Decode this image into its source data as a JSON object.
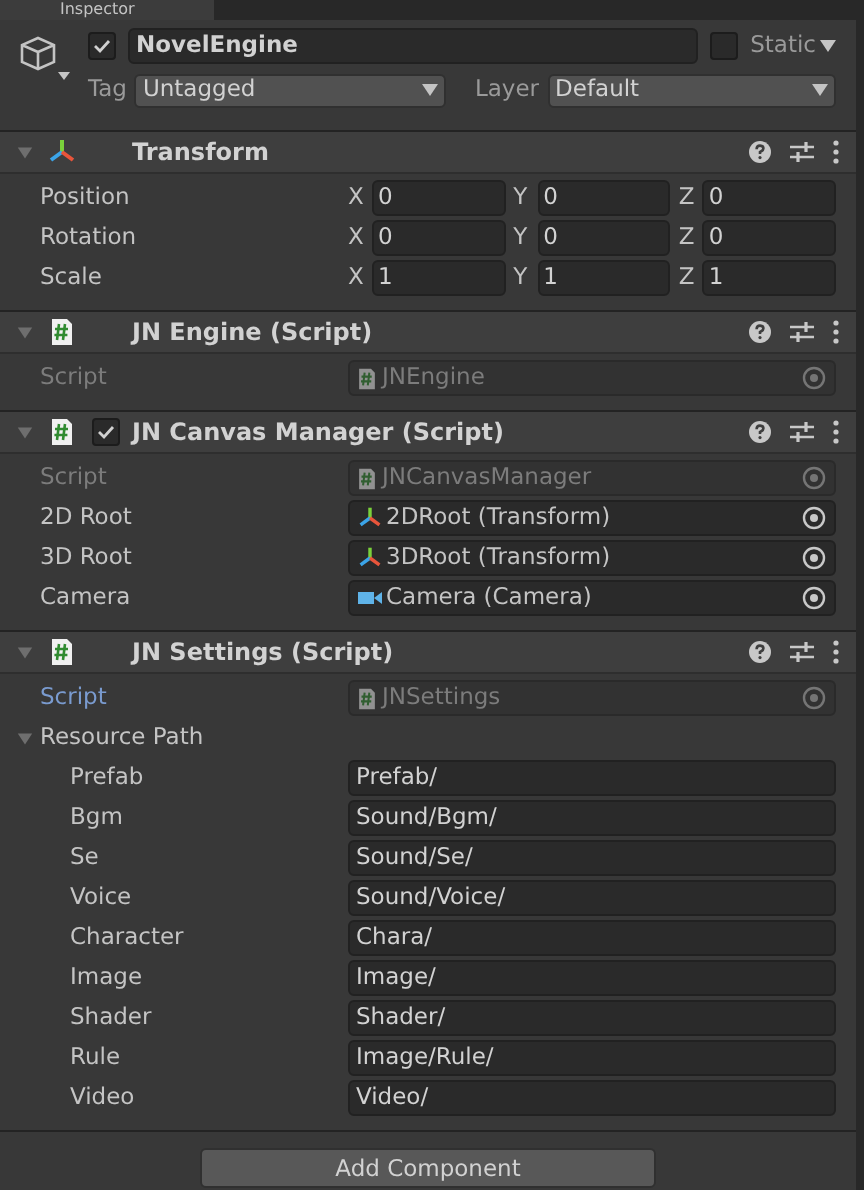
{
  "tab": {
    "title": "Inspector"
  },
  "object": {
    "active": true,
    "name": "NovelEngine",
    "static": false,
    "static_label": "Static",
    "tag_label": "Tag",
    "tag": "Untagged",
    "layer_label": "Layer",
    "layer": "Default"
  },
  "components": [
    {
      "kind": "transform",
      "title": "Transform",
      "expanded": true,
      "rows": [
        {
          "label": "Position",
          "values": [
            {
              "axis": "X",
              "value": "0"
            },
            {
              "axis": "Y",
              "value": "0"
            },
            {
              "axis": "Z",
              "value": "0"
            }
          ]
        },
        {
          "label": "Rotation",
          "values": [
            {
              "axis": "X",
              "value": "0"
            },
            {
              "axis": "Y",
              "value": "0"
            },
            {
              "axis": "Z",
              "value": "0"
            }
          ]
        },
        {
          "label": "Scale",
          "values": [
            {
              "axis": "X",
              "value": "1"
            },
            {
              "axis": "Y",
              "value": "1"
            },
            {
              "axis": "Z",
              "value": "1"
            }
          ]
        }
      ]
    },
    {
      "kind": "script",
      "title": "JN Engine (Script)",
      "expanded": true,
      "fields": [
        {
          "kind": "script",
          "label": "Script",
          "value": "JNEngine",
          "highlighted": false
        }
      ]
    },
    {
      "kind": "script",
      "title": "JN Canvas Manager (Script)",
      "expanded": true,
      "toggle": {
        "checked": true
      },
      "fields": [
        {
          "kind": "script",
          "label": "Script",
          "value": "JNCanvasManager",
          "highlighted": false
        },
        {
          "kind": "transform_reference",
          "label": "2D Root",
          "value": "2DRoot (Transform)"
        },
        {
          "kind": "transform_reference",
          "label": "3D Root",
          "value": "3DRoot (Transform)"
        },
        {
          "kind": "camera_reference",
          "label": "Camera",
          "value": "Camera (Camera)"
        }
      ]
    },
    {
      "kind": "script",
      "title": "JN Settings (Script)",
      "expanded": true,
      "fields": [
        {
          "kind": "script",
          "label": "Script",
          "value": "JNSettings",
          "highlighted": true
        },
        {
          "kind": "foldout",
          "label": "Resource Path",
          "expanded": true,
          "children": [
            {
              "label": "Prefab",
              "value": "Prefab/"
            },
            {
              "label": "Bgm",
              "value": "Sound/Bgm/"
            },
            {
              "label": "Se",
              "value": "Sound/Se/"
            },
            {
              "label": "Voice",
              "value": "Sound/Voice/"
            },
            {
              "label": "Character",
              "value": "Chara/"
            },
            {
              "label": "Image",
              "value": "Image/"
            },
            {
              "label": "Shader",
              "value": "Shader/"
            },
            {
              "label": "Rule",
              "value": "Image/Rule/"
            },
            {
              "label": "Video",
              "value": "Video/"
            }
          ]
        }
      ]
    }
  ],
  "add_button": "Add Component"
}
